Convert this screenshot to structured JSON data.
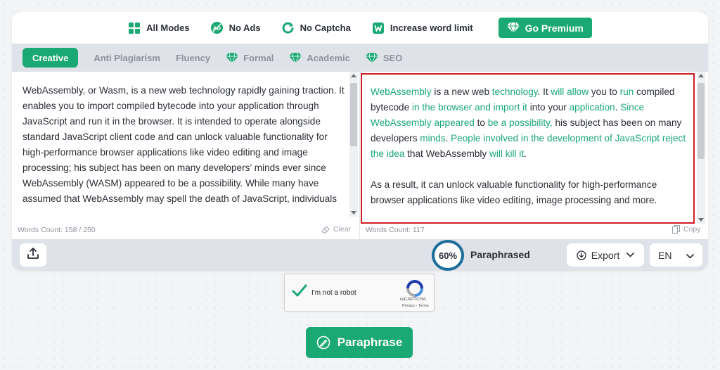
{
  "colors": {
    "accent": "#1aa874",
    "highlight_border": "#d21d24",
    "ring": "#1d6f9b",
    "bar_bg": "#dfe2e8"
  },
  "features": [
    {
      "label": "All Modes",
      "icon": "grid-icon"
    },
    {
      "label": "No Ads",
      "icon": "no-ads-icon"
    },
    {
      "label": "No Captcha",
      "icon": "refresh-icon"
    },
    {
      "label": "Increase word limit",
      "icon": "word-icon"
    }
  ],
  "premium": {
    "label": "Go Premium",
    "icon": "diamond-icon"
  },
  "modes": [
    {
      "label": "Creative",
      "active": true,
      "premium": false
    },
    {
      "label": "Anti Plagiarism",
      "active": false,
      "premium": false
    },
    {
      "label": "Fluency",
      "active": false,
      "premium": false
    },
    {
      "label": "Formal",
      "active": false,
      "premium": true
    },
    {
      "label": "Academic",
      "active": false,
      "premium": true
    },
    {
      "label": "SEO",
      "active": false,
      "premium": true
    }
  ],
  "input": {
    "text": "WebAssembly, or Wasm, is a new web technology rapidly gaining traction. It enables you to import compiled bytecode into your application through JavaScript and run it in the browser. It is intended to operate alongside standard JavaScript client code and can unlock valuable functionality for high-performance browser applications like video editing and image processing; his subject has been on many developers’ minds ever since WebAssembly (WASM) appeared to be a possibility. While many have assumed that WebAssembly may spell the death of JavaScript, individuals",
    "word_count": "Words Count: 158 / 250",
    "clear_label": "Clear"
  },
  "output": {
    "p1": [
      {
        "t": "WebAssembly",
        "g": true
      },
      {
        "t": " is a new web ",
        "g": false
      },
      {
        "t": "technology",
        "g": true
      },
      {
        "t": ". It ",
        "g": false
      },
      {
        "t": "will allow",
        "g": true
      },
      {
        "t": " you to ",
        "g": false
      },
      {
        "t": "run",
        "g": true
      },
      {
        "t": " compiled bytecode ",
        "g": false
      },
      {
        "t": "in the browser and import it",
        "g": true
      },
      {
        "t": " into your ",
        "g": false
      },
      {
        "t": "application",
        "g": true
      },
      {
        "t": ". ",
        "g": false
      },
      {
        "t": "Since WebAssembly appeared",
        "g": true
      },
      {
        "t": " to ",
        "g": false
      },
      {
        "t": "be a possibility,",
        "g": true
      },
      {
        "t": " his subject has been on many developers ",
        "g": false
      },
      {
        "t": "minds",
        "g": true
      },
      {
        "t": ". ",
        "g": false
      },
      {
        "t": "People involved in the development of JavaScript reject the idea",
        "g": true
      },
      {
        "t": " that WebAssembly ",
        "g": false
      },
      {
        "t": "will kill it",
        "g": true
      },
      {
        "t": ".",
        "g": false
      }
    ],
    "p2": "As a result, it can unlock valuable functionality for high-performance browser applications like video editing, image processing and more.",
    "word_count": "Words Count: 117",
    "copy_label": "Copy"
  },
  "bottom": {
    "percent": "60%",
    "paraphrased_label": "Paraphrased",
    "export_label": "Export",
    "language": "EN"
  },
  "captcha": {
    "label": "I'm not a robot",
    "brand": "reCAPTCHA",
    "terms": "Privacy - Terms"
  },
  "paraphrase_label": "Paraphrase"
}
